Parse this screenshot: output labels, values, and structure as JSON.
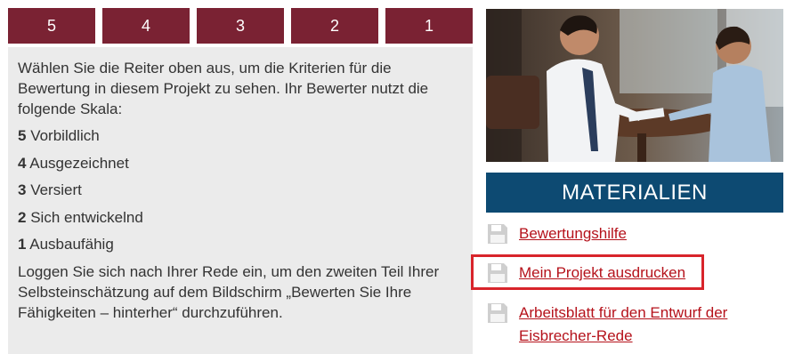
{
  "tabs": [
    "5",
    "4",
    "3",
    "2",
    "1"
  ],
  "content": {
    "intro": "Wählen Sie die Reiter oben aus, um die Kriterien für die Bewertung in diesem Projekt zu sehen. Ihr Bewerter nutzt die folgende Skala:",
    "scale": [
      {
        "num": "5",
        "label": "Vorbildlich"
      },
      {
        "num": "4",
        "label": "Ausgezeichnet"
      },
      {
        "num": "3",
        "label": "Versiert"
      },
      {
        "num": "2",
        "label": "Sich entwickelnd"
      },
      {
        "num": "1",
        "label": "Ausbaufähig"
      }
    ],
    "outro": "Loggen Sie sich nach Ihrer Rede ein, um den zweiten Teil Ihrer Selbsteinschätzung auf dem Bildschirm „Bewerten Sie Ihre Fähigkeiten – hinterher“ durchzuführen."
  },
  "materials": {
    "header": "MATERIALIEN",
    "links": [
      {
        "label": "Bewertungshilfe",
        "icon": "floppy-disk-icon"
      },
      {
        "label": "Mein Projekt ausdrucken",
        "icon": "floppy-disk-icon"
      },
      {
        "label": "Arbeitsblatt für den Entwurf der Eisbrecher-Rede",
        "icon": "floppy-disk-icon"
      }
    ]
  },
  "colors": {
    "tab_bg": "#7a2233",
    "header_bg": "#0d4a72",
    "link": "#b5121b",
    "highlight": "#d8242b",
    "panel_bg": "#ebebeb"
  }
}
